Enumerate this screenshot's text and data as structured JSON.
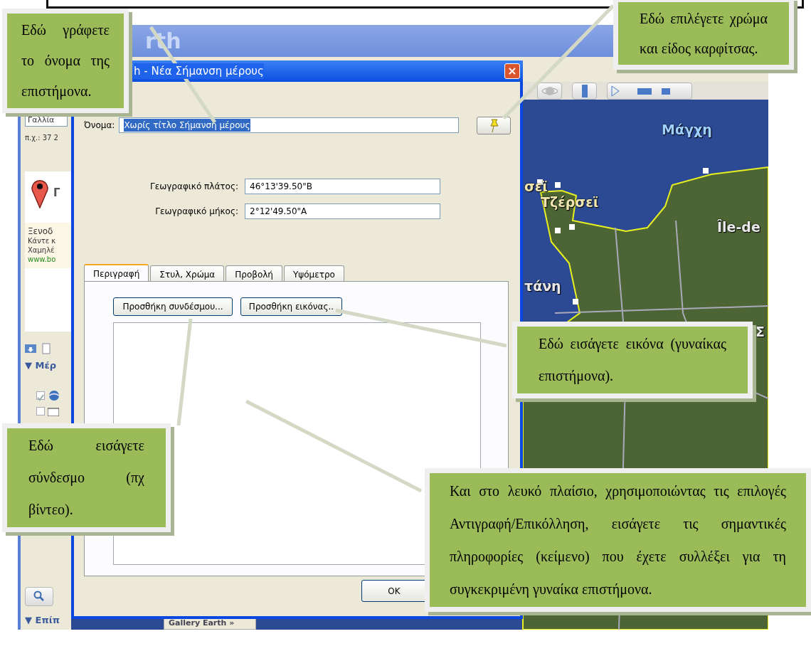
{
  "app_window": {
    "title": "rth",
    "sidebar": {
      "search": {
        "value": "Γαλλία"
      },
      "hint": "π.χ.: 37 2",
      "result_title": "Γ",
      "ad": {
        "title": "Ξενοδ",
        "lines": [
          "Κάντε κ",
          "Χαμηλέ"
        ],
        "url": "www.bo"
      },
      "places_header": "▼ Μέρ",
      "places": [
        {
          "checked": true
        },
        {
          "checked": false
        }
      ],
      "layers_header": "▼ Επίπ"
    },
    "gallery_button": "Gallery Earth »",
    "map": {
      "labels": [
        "Μάγχη",
        "σεϊ",
        "Τζέρσεϊ",
        "Île-de",
        "τάνη",
        "Σ"
      ]
    }
  },
  "dialog": {
    "title": "h - Νέα Σήμανση μέρους",
    "close": "×",
    "name": {
      "label": "Όνομα:",
      "value": "Χωρίς τίτλο Σήμανση μέρους",
      "selected": true
    },
    "coordinates": [
      {
        "label": "Γεωγραφικό πλάτος:",
        "value": "46°13'39.50\"Β"
      },
      {
        "label": "Γεωγραφικό μήκος:",
        "value": "2°12'49.50\"Α"
      }
    ],
    "tabs": [
      {
        "label": "Περιγραφή",
        "selected": true
      },
      {
        "label": "Στυλ, Χρώμα",
        "selected": false
      },
      {
        "label": "Προβολή",
        "selected": false
      },
      {
        "label": "Υψόμετρο",
        "selected": false
      }
    ],
    "buttons": [
      "Προσθήκη συνδέσμου...",
      "Προσθήκη εικόνας.."
    ],
    "ok": "OK"
  },
  "callouts": [
    {
      "text": "Εδώ γράφετε το όνομα της επιστήμονα."
    },
    {
      "text": "Εδώ επιλέγετε χρώμα και είδος καρφίτσας."
    },
    {
      "text": "Εδώ εισάγετε εικόνα (γυναίκας επιστήμονα)."
    },
    {
      "text": "Εδώ εισάγετε σύνδεσμο (πχ βίντεο)."
    },
    {
      "text": "Και στο λευκό πλαίσιο, χρησιμοποιώντας τις επιλογές Αντιγραφή/Επικόλληση, εισάγετε τις σημαντικές πληροφορίες (κείμενο) που έχετε συλλέξει για τη συγκεκριμένη γυναίκα επιστήμονα."
    }
  ]
}
